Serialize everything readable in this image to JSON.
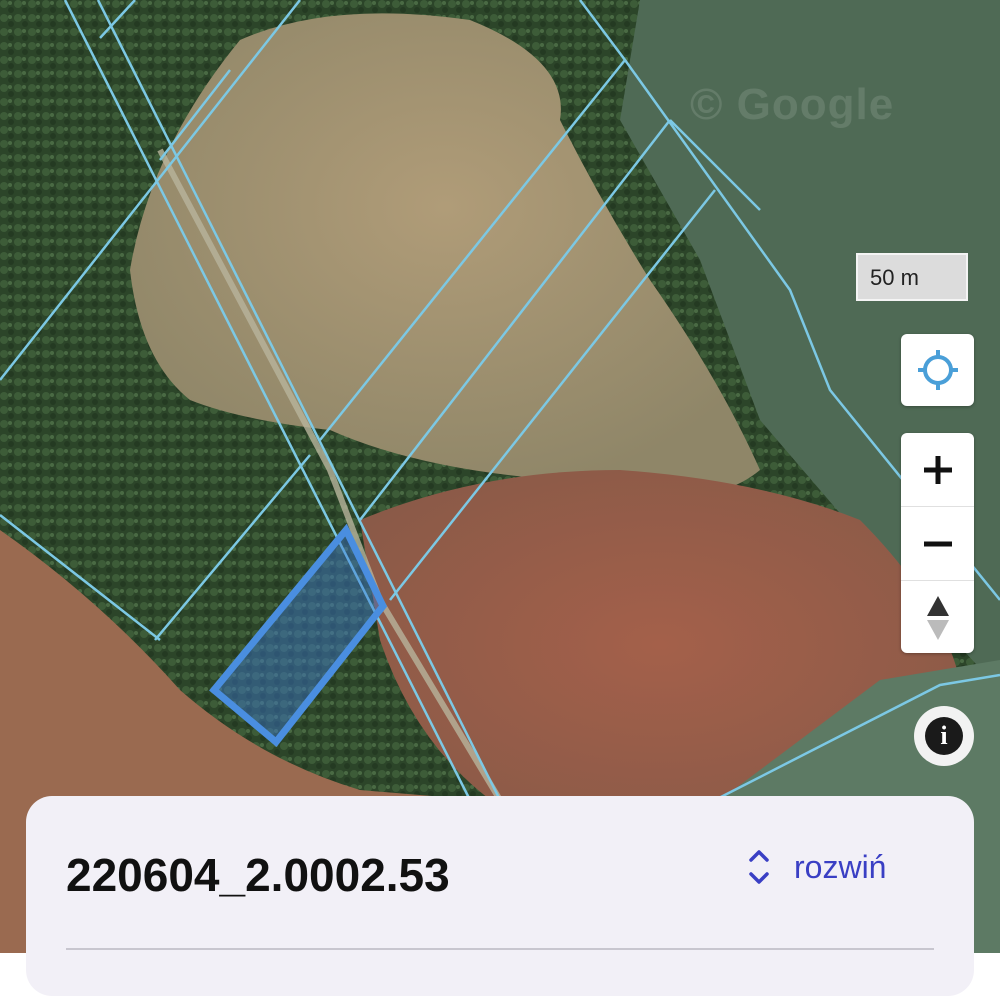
{
  "map": {
    "watermark": "© Google",
    "scale_label": "50 m",
    "colors": {
      "parcel_line": "#7cc8e4",
      "selected_parcel": "#4a8ee0",
      "forest": "#2f4a2c",
      "field": "#a08d6a",
      "plowed_field": "#9a5a44"
    }
  },
  "controls": {
    "locate_icon": "crosshair-locate-icon",
    "zoom_in_icon": "plus-icon",
    "zoom_out_icon": "minus-icon",
    "compass_icon": "compass-north-icon",
    "info_icon": "info-icon",
    "info_glyph": "i"
  },
  "panel": {
    "parcel_id": "220604_2.0002.53",
    "expand_label": "rozwiń",
    "expand_icon": "chevron-up-down-icon"
  }
}
